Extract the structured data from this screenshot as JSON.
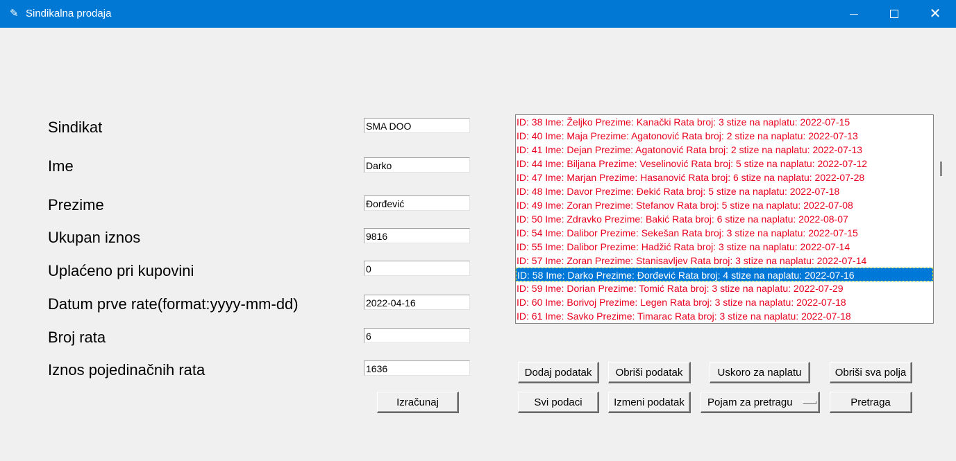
{
  "window": {
    "title": "Sindikalna prodaja",
    "controls": [
      "minimize",
      "maximize",
      "close"
    ]
  },
  "form": {
    "sindikat_label": "Sindikat",
    "sindikat_value": "SMA DOO",
    "ime_label": "Ime",
    "ime_value": "Darko",
    "prezime_label": "Prezime",
    "prezime_value": "Đorđević",
    "ukupan_label": "Ukupan iznos",
    "ukupan_value": "9816",
    "uplaceno_label": "Uplaćeno pri kupovini",
    "uplaceno_value": "0",
    "datum_label": "Datum prve rate(format:yyyy-mm-dd)",
    "datum_value": "2022-04-16",
    "broj_rata_label": "Broj rata",
    "broj_rata_value": "6",
    "iznos_label": "Iznos pojedinačnih rata",
    "iznos_value": "1636",
    "izracunaj_label": "Izračunaj"
  },
  "list": {
    "text_color": "#e8001e",
    "selected_index": 11,
    "items": [
      "ID:  38 Ime: Željko Prezime: Kanački  Rata broj:  3  stize na naplatu:   2022-07-15",
      "ID:  40 Ime: Maja Prezime: Agatonović  Rata broj:  2  stize na naplatu:   2022-07-13",
      "ID:  41 Ime: Dejan Prezime: Agatonović  Rata broj:  2  stize na naplatu:   2022-07-13",
      "ID:  44 Ime: Biljana Prezime: Veselinović  Rata broj:  5  stize na naplatu:   2022-07-12",
      "ID:  47 Ime: Marjan Prezime: Hasanović  Rata broj:  6  stize na naplatu:   2022-07-28",
      "ID:  48 Ime: Davor Prezime: Đekić  Rata broj:  5  stize na naplatu:   2022-07-18",
      "ID:  49 Ime: Zoran Prezime: Stefanov  Rata broj:  5  stize na naplatu:   2022-07-08",
      "ID:  50 Ime: Zdravko Prezime: Bakić  Rata broj:  6  stize na naplatu:   2022-08-07",
      "ID:  54 Ime: Dalibor Prezime: Sekešan  Rata broj:  3  stize na naplatu:   2022-07-15",
      "ID:  55 Ime: Dalibor Prezime: Hadžić  Rata broj:  3  stize na naplatu:   2022-07-14",
      "ID:  57 Ime: Zoran Prezime: Stanisavljev  Rata broj:  3  stize na naplatu:   2022-07-14",
      "ID:  58 Ime: Darko Prezime: Đorđević  Rata broj:  4  stize na naplatu:   2022-07-16",
      "ID:  59 Ime: Dorian Prezime: Tomić  Rata broj:  3  stize na naplatu:   2022-07-29",
      "ID:  60 Ime: Borivoj Prezime: Legen  Rata broj:  3  stize na naplatu:   2022-07-18",
      "ID:  61 Ime: Savko Prezime: Timarac  Rata broj:  3  stize na naplatu:   2022-07-18"
    ]
  },
  "buttons": {
    "dodaj": "Dodaj podatak",
    "obrisi": "Obriši podatak",
    "uskoro": "Uskoro za naplatu",
    "obrisi_sva": "Obriši sva polja",
    "svi": "Svi podaci",
    "izmeni": "Izmeni podatak",
    "pojam": "Pojam za pretragu",
    "pretraga": "Pretraga"
  }
}
